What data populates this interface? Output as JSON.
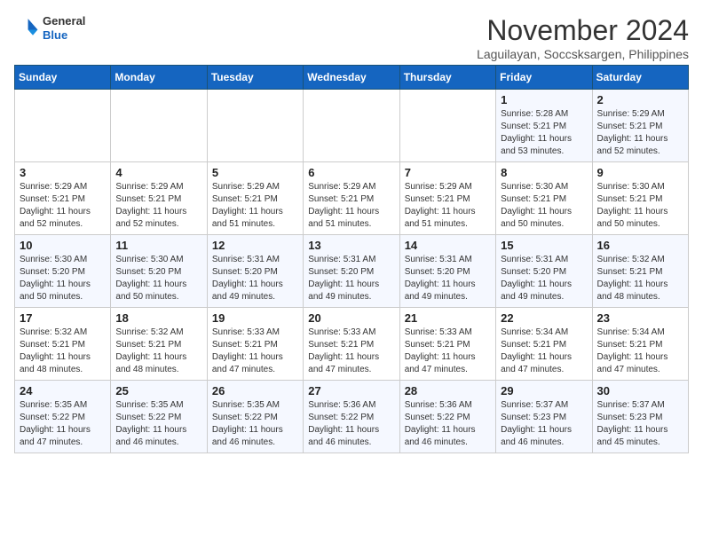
{
  "header": {
    "logo": {
      "line1": "General",
      "line2": "Blue"
    },
    "title": "November 2024",
    "location": "Laguilayan, Soccsksargen, Philippines"
  },
  "weekdays": [
    "Sunday",
    "Monday",
    "Tuesday",
    "Wednesday",
    "Thursday",
    "Friday",
    "Saturday"
  ],
  "weeks": [
    [
      {
        "day": "",
        "info": ""
      },
      {
        "day": "",
        "info": ""
      },
      {
        "day": "",
        "info": ""
      },
      {
        "day": "",
        "info": ""
      },
      {
        "day": "",
        "info": ""
      },
      {
        "day": "1",
        "info": "Sunrise: 5:28 AM\nSunset: 5:21 PM\nDaylight: 11 hours\nand 53 minutes."
      },
      {
        "day": "2",
        "info": "Sunrise: 5:29 AM\nSunset: 5:21 PM\nDaylight: 11 hours\nand 52 minutes."
      }
    ],
    [
      {
        "day": "3",
        "info": "Sunrise: 5:29 AM\nSunset: 5:21 PM\nDaylight: 11 hours\nand 52 minutes."
      },
      {
        "day": "4",
        "info": "Sunrise: 5:29 AM\nSunset: 5:21 PM\nDaylight: 11 hours\nand 52 minutes."
      },
      {
        "day": "5",
        "info": "Sunrise: 5:29 AM\nSunset: 5:21 PM\nDaylight: 11 hours\nand 51 minutes."
      },
      {
        "day": "6",
        "info": "Sunrise: 5:29 AM\nSunset: 5:21 PM\nDaylight: 11 hours\nand 51 minutes."
      },
      {
        "day": "7",
        "info": "Sunrise: 5:29 AM\nSunset: 5:21 PM\nDaylight: 11 hours\nand 51 minutes."
      },
      {
        "day": "8",
        "info": "Sunrise: 5:30 AM\nSunset: 5:21 PM\nDaylight: 11 hours\nand 50 minutes."
      },
      {
        "day": "9",
        "info": "Sunrise: 5:30 AM\nSunset: 5:21 PM\nDaylight: 11 hours\nand 50 minutes."
      }
    ],
    [
      {
        "day": "10",
        "info": "Sunrise: 5:30 AM\nSunset: 5:20 PM\nDaylight: 11 hours\nand 50 minutes."
      },
      {
        "day": "11",
        "info": "Sunrise: 5:30 AM\nSunset: 5:20 PM\nDaylight: 11 hours\nand 50 minutes."
      },
      {
        "day": "12",
        "info": "Sunrise: 5:31 AM\nSunset: 5:20 PM\nDaylight: 11 hours\nand 49 minutes."
      },
      {
        "day": "13",
        "info": "Sunrise: 5:31 AM\nSunset: 5:20 PM\nDaylight: 11 hours\nand 49 minutes."
      },
      {
        "day": "14",
        "info": "Sunrise: 5:31 AM\nSunset: 5:20 PM\nDaylight: 11 hours\nand 49 minutes."
      },
      {
        "day": "15",
        "info": "Sunrise: 5:31 AM\nSunset: 5:20 PM\nDaylight: 11 hours\nand 49 minutes."
      },
      {
        "day": "16",
        "info": "Sunrise: 5:32 AM\nSunset: 5:21 PM\nDaylight: 11 hours\nand 48 minutes."
      }
    ],
    [
      {
        "day": "17",
        "info": "Sunrise: 5:32 AM\nSunset: 5:21 PM\nDaylight: 11 hours\nand 48 minutes."
      },
      {
        "day": "18",
        "info": "Sunrise: 5:32 AM\nSunset: 5:21 PM\nDaylight: 11 hours\nand 48 minutes."
      },
      {
        "day": "19",
        "info": "Sunrise: 5:33 AM\nSunset: 5:21 PM\nDaylight: 11 hours\nand 47 minutes."
      },
      {
        "day": "20",
        "info": "Sunrise: 5:33 AM\nSunset: 5:21 PM\nDaylight: 11 hours\nand 47 minutes."
      },
      {
        "day": "21",
        "info": "Sunrise: 5:33 AM\nSunset: 5:21 PM\nDaylight: 11 hours\nand 47 minutes."
      },
      {
        "day": "22",
        "info": "Sunrise: 5:34 AM\nSunset: 5:21 PM\nDaylight: 11 hours\nand 47 minutes."
      },
      {
        "day": "23",
        "info": "Sunrise: 5:34 AM\nSunset: 5:21 PM\nDaylight: 11 hours\nand 47 minutes."
      }
    ],
    [
      {
        "day": "24",
        "info": "Sunrise: 5:35 AM\nSunset: 5:22 PM\nDaylight: 11 hours\nand 47 minutes."
      },
      {
        "day": "25",
        "info": "Sunrise: 5:35 AM\nSunset: 5:22 PM\nDaylight: 11 hours\nand 46 minutes."
      },
      {
        "day": "26",
        "info": "Sunrise: 5:35 AM\nSunset: 5:22 PM\nDaylight: 11 hours\nand 46 minutes."
      },
      {
        "day": "27",
        "info": "Sunrise: 5:36 AM\nSunset: 5:22 PM\nDaylight: 11 hours\nand 46 minutes."
      },
      {
        "day": "28",
        "info": "Sunrise: 5:36 AM\nSunset: 5:22 PM\nDaylight: 11 hours\nand 46 minutes."
      },
      {
        "day": "29",
        "info": "Sunrise: 5:37 AM\nSunset: 5:23 PM\nDaylight: 11 hours\nand 46 minutes."
      },
      {
        "day": "30",
        "info": "Sunrise: 5:37 AM\nSunset: 5:23 PM\nDaylight: 11 hours\nand 45 minutes."
      }
    ]
  ]
}
